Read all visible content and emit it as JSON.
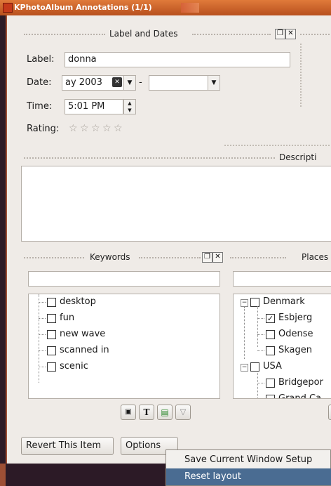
{
  "window": {
    "title": "KPhotoAlbum Annotations (1/1)"
  },
  "label_dates": {
    "dock_title": "Label and Dates",
    "label_caption": "Label:",
    "label_value": "donna",
    "date_caption": "Date:",
    "date_value": "ay 2003",
    "date_separator": "-",
    "date_end_value": "",
    "time_caption": "Time:",
    "time_value": "5:01 PM",
    "rating_caption": "Rating:",
    "rating_value": 0,
    "rating_max": 5
  },
  "description": {
    "dock_title": "Descripti",
    "value": ""
  },
  "keywords": {
    "dock_title": "Keywords",
    "search_value": "",
    "items": [
      {
        "label": "desktop",
        "checked": false
      },
      {
        "label": "fun",
        "checked": false
      },
      {
        "label": "new wave",
        "checked": false
      },
      {
        "label": "scanned in",
        "checked": false
      },
      {
        "label": "scenic",
        "checked": false
      }
    ]
  },
  "places": {
    "dock_title": "Places",
    "search_value": "",
    "groups": [
      {
        "label": "Denmark",
        "checked": false,
        "expanded": true,
        "children": [
          {
            "label": "Esbjerg",
            "checked": true
          },
          {
            "label": "Odense",
            "checked": false
          },
          {
            "label": "Skagen",
            "checked": false
          }
        ]
      },
      {
        "label": "USA",
        "checked": false,
        "expanded": true,
        "children": [
          {
            "label": "Bridgepor",
            "checked": false
          },
          {
            "label": "Grand Ca",
            "checked": false
          }
        ]
      }
    ]
  },
  "buttons": {
    "revert": "Revert This Item",
    "options": "Options"
  },
  "options_menu": {
    "items": [
      {
        "label": "Save Current Window Setup",
        "active": false
      },
      {
        "label": "Reset layout",
        "active": true
      }
    ]
  },
  "colors": {
    "titlebar": "#c8602a",
    "menu_highlight": "#4a6c92"
  }
}
